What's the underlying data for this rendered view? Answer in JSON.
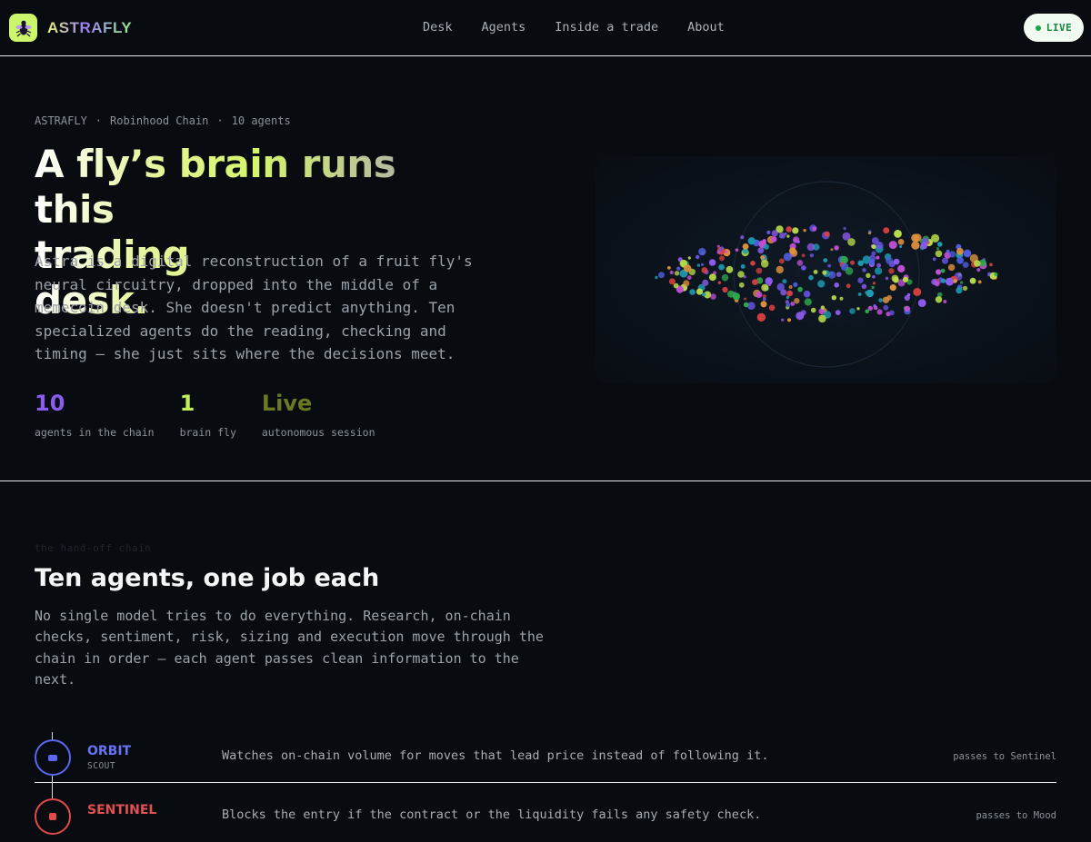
{
  "brand": {
    "name": "ASTRAFLY",
    "logo_color": "#cdf66a"
  },
  "nav": {
    "items": [
      {
        "label": "Desk"
      },
      {
        "label": "Agents"
      },
      {
        "label": "Inside a trade"
      },
      {
        "label": "About"
      }
    ]
  },
  "status": {
    "label": "LIVE",
    "color": "#19a34a"
  },
  "hero": {
    "eyebrow": [
      "ASTRAFLY",
      "·",
      "Robinhood Chain",
      "·",
      "10 agents"
    ],
    "headline_line1": "A fly’s brain runs this",
    "headline_line2": "trading desk.",
    "lede": "Astra is a digital reconstruction of a fruit fly's neural circuitry, dropped into the middle of a memecoin desk. She doesn't predict anything. Ten specialized agents do the reading, checking and timing — she just sits where the decisions meet.",
    "stats": [
      {
        "value": "10",
        "label": "agents in the chain",
        "color": "#8a5cf0"
      },
      {
        "value": "1",
        "label": "brain fly",
        "color": "#c4ee59"
      },
      {
        "value": "Live",
        "label": "autonomous session",
        "color": "#6b7a22"
      }
    ]
  },
  "visual": {
    "type": "neural-cluster",
    "palette": [
      "#8f5cf0",
      "#6a54e8",
      "#e0913e",
      "#1d9bb3",
      "#2fa84c",
      "#d9403f",
      "#b9dd4a",
      "#4f5fe0",
      "#c44fd6"
    ]
  },
  "agents_section": {
    "kicker": "the hand-off chain",
    "title": "Ten agents, one job each",
    "body": "No single model tries to do everything. Research, on-chain checks, sentiment, risk, sizing and execution move through the chain in order — each agent passes clean information to the next.",
    "agents": [
      {
        "name": "ORBIT",
        "role": "SCOUT",
        "description": "Watches on-chain volume for moves that lead price instead of following it.",
        "passes_to": "passes to Sentinel",
        "color": "#5a67f0",
        "icon": "infinity-icon"
      },
      {
        "name": "SENTINEL",
        "role": "",
        "description": "Blocks the entry if the contract or the liquidity fails any safety check.",
        "passes_to": "passes to Mood",
        "color": "#e04a4a",
        "icon": "shield-icon"
      }
    ]
  }
}
